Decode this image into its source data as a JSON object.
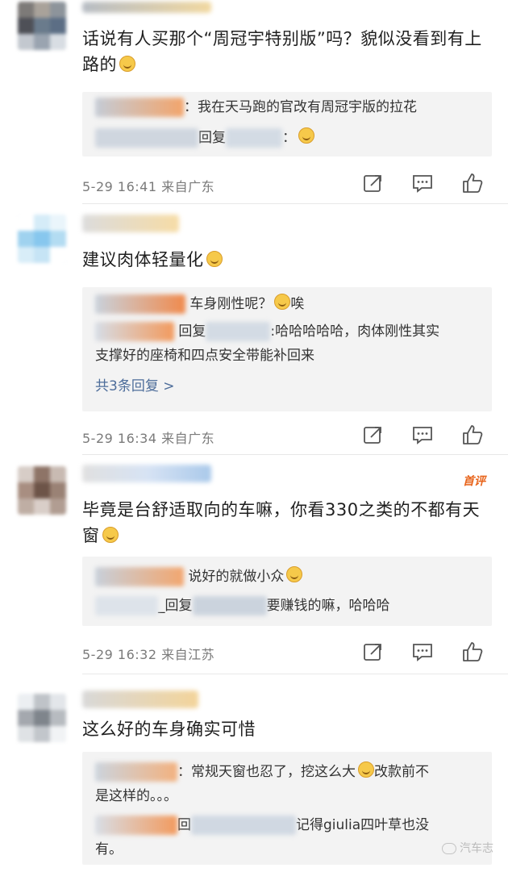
{
  "comments": [
    {
      "text": "话说有人买那个“周冠宇特别版”吗？貌似没看到有上路的",
      "replies": [
        {
          "suffix": "：我在天马跑的官改有周冠宇版的拉花"
        },
        {
          "prefix": "回复",
          "suffix": "："
        }
      ],
      "meta": "5-29 16:41 来自广东"
    },
    {
      "text": "建议肉体轻量化",
      "replies": [
        {
          "suffix": "车身刚性呢？",
          "tail": "唉"
        },
        {
          "prefix": "回复",
          "suffix": ":哈哈哈哈哈，肉体刚性其实",
          "cont": "支撑好的座椅和四点安全带能补回来"
        }
      ],
      "more": "共3条回复 >",
      "meta": "5-29 16:34 来自广东"
    },
    {
      "text": "毕竟是台舒适取向的车嘛，你看330之类的不都有天窗",
      "tag": "首评",
      "replies": [
        {
          "suffix": "说好的就做小众"
        },
        {
          "prefix": "_回复",
          "suffix": "要赚钱的嘛，哈哈哈"
        }
      ],
      "meta": "5-29 16:32 来自江苏"
    },
    {
      "text": "这么好的车身确实可惜",
      "replies": [
        {
          "suffix": "：常规天窗也忍了，挖这么大",
          "tail": "改款前不",
          "cont": "是这样的。。。"
        },
        {
          "prefix": "回",
          "suffix": "记得giulia四叶草也没",
          "cont": "有。"
        }
      ],
      "meta": ""
    }
  ],
  "watermark": "汽车志",
  "icons": [
    "share-icon",
    "comment-icon",
    "like-icon"
  ]
}
